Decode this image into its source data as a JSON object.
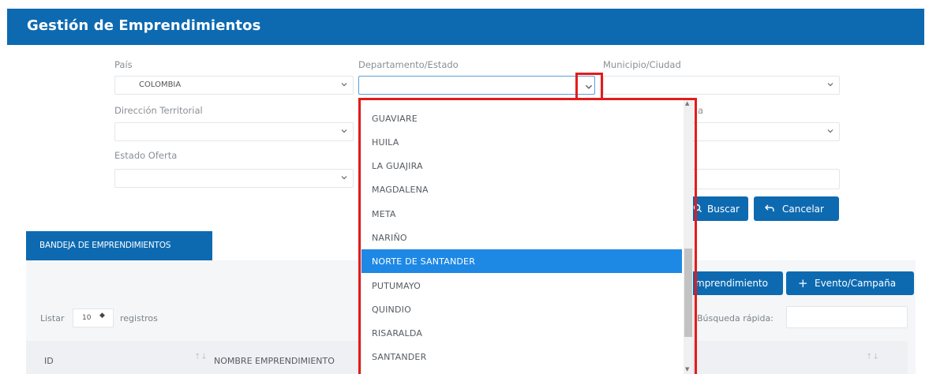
{
  "header": {
    "title": "Gestión de Emprendimientos"
  },
  "filters": {
    "pais": {
      "label": "País",
      "value": "COLOMBIA"
    },
    "departamento": {
      "label": "Departamento/Estado",
      "value": ""
    },
    "municipio": {
      "label": "Municipio/Ciudad",
      "value": ""
    },
    "direccion": {
      "label": "Dirección Territorial",
      "value": ""
    },
    "estado_oferta": {
      "label": "Estado Oferta",
      "value": ""
    },
    "hidden_label_fragment": "a"
  },
  "buttons": {
    "buscar": "Buscar",
    "cancelar": "Cancelar",
    "emprendimiento": "mprendimiento",
    "evento": "Evento/Campaña"
  },
  "bandeja": {
    "tab_label": "BANDEJA DE EMPRENDIMIENTOS",
    "listar_label": "Listar",
    "page_size": "10",
    "registros_label": "registros",
    "search_label": "Búsqueda rápida:",
    "columns": {
      "id": "ID",
      "nombre": "NOMBRE EMPRENDIMIENTO"
    }
  },
  "dropdown": {
    "options": [
      "GUAVIARE",
      "HUILA",
      "LA GUAJIRA",
      "MAGDALENA",
      "META",
      "NARIÑO",
      "NORTE DE SANTANDER",
      "PUTUMAYO",
      "QUINDIO",
      "RISARALDA",
      "SANTANDER"
    ],
    "highlighted": "NORTE DE SANTANDER"
  },
  "colors": {
    "primary": "#0d6ab1",
    "highlight": "#1e88e5",
    "annotation": "#e31b1b"
  }
}
